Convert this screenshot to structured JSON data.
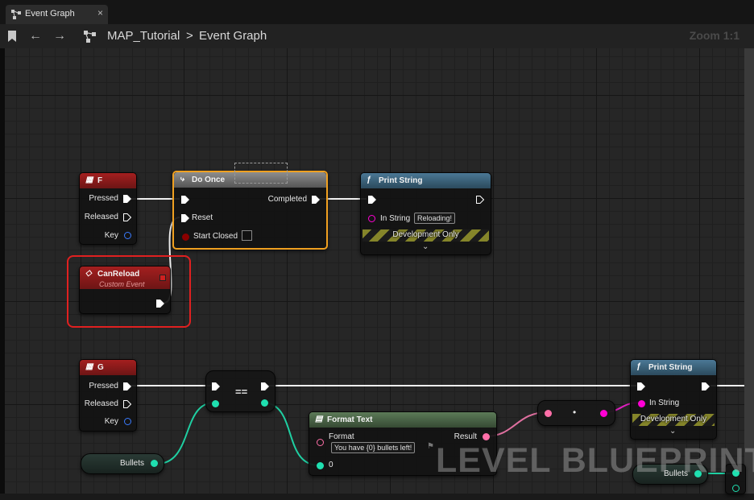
{
  "tab": {
    "label": "Event Graph",
    "close": "×"
  },
  "toolbar": {
    "back": "←",
    "forward": "→",
    "crumb_root": "MAP_Tutorial",
    "separator": ">",
    "crumb_current": "Event Graph",
    "zoom": "Zoom 1:1"
  },
  "nodes": {
    "key_f": {
      "title": "F",
      "pins": [
        "Pressed",
        "Released",
        "Key"
      ]
    },
    "do_once": {
      "title": "Do Once",
      "completed": "Completed",
      "reset": "Reset",
      "start_closed": "Start Closed"
    },
    "print_string_1": {
      "title": "Print String",
      "in_string": "In String",
      "value": "Reloading!",
      "dev_only": "Development Only"
    },
    "can_reload": {
      "title": "CanReload",
      "subtitle": "Custom Event"
    },
    "key_g": {
      "title": "G",
      "pins": [
        "Pressed",
        "Released",
        "Key"
      ]
    },
    "equals": {
      "title": "=="
    },
    "format_text": {
      "title": "Format Text",
      "format": "Format",
      "format_value": "You have {0} bullets left!",
      "result": "Result",
      "arg0": "0"
    },
    "convert": {
      "title": "•"
    },
    "print_string_2": {
      "title": "Print String",
      "in_string": "In String",
      "dev_only": "Development Only"
    },
    "bullets_1": {
      "label": "Bullets"
    },
    "bullets_2": {
      "label": "Bullets"
    }
  },
  "watermark": "LEVEL BLUEPRINT",
  "colors": {
    "exec": "#ffffff",
    "integer": "#1fe0b0",
    "text": "#ff6fa8",
    "string": "#ff00d4",
    "bool": "#8b0000",
    "selection": "#f0a020",
    "highlight": "#e02020"
  }
}
